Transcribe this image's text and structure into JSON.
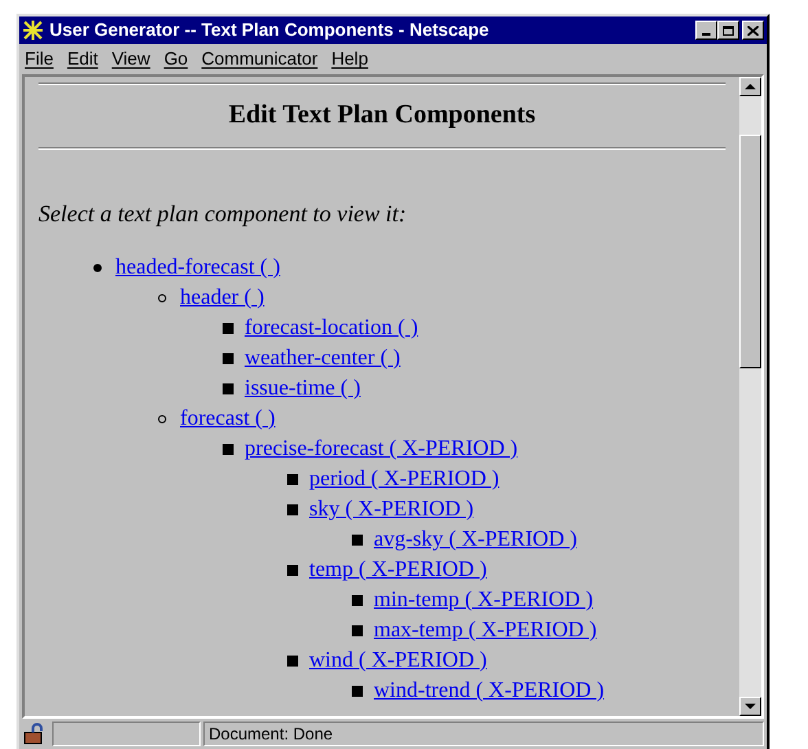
{
  "window": {
    "title": "User Generator -- Text Plan Components - Netscape"
  },
  "menu": [
    "File",
    "Edit",
    "View",
    "Go",
    "Communicator",
    "Help"
  ],
  "page": {
    "heading": "Edit Text Plan Components",
    "instruction": "Select a text plan component to view it:",
    "tree": [
      {
        "label": "headed-forecast ( )",
        "children": [
          {
            "label": "header ( )",
            "children": [
              {
                "label": "forecast-location ( )"
              },
              {
                "label": "weather-center ( )"
              },
              {
                "label": "issue-time ( )"
              }
            ]
          },
          {
            "label": "forecast ( )",
            "children": [
              {
                "label": "precise-forecast ( X-PERIOD )",
                "children": [
                  {
                    "label": "period ( X-PERIOD )"
                  },
                  {
                    "label": "sky ( X-PERIOD )",
                    "children": [
                      {
                        "label": "avg-sky ( X-PERIOD )"
                      }
                    ]
                  },
                  {
                    "label": "temp ( X-PERIOD )",
                    "children": [
                      {
                        "label": "min-temp ( X-PERIOD )"
                      },
                      {
                        "label": "max-temp ( X-PERIOD )"
                      }
                    ]
                  },
                  {
                    "label": "wind ( X-PERIOD )",
                    "children": [
                      {
                        "label": "wind-trend ( X-PERIOD )"
                      }
                    ]
                  }
                ]
              }
            ]
          }
        ]
      }
    ]
  },
  "status_bar": {
    "text": "Document: Done"
  }
}
